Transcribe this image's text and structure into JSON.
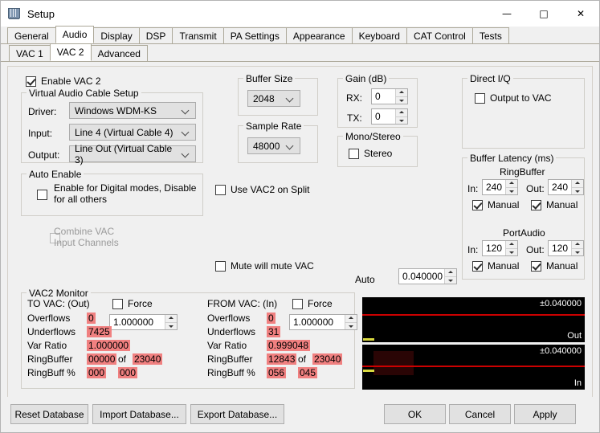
{
  "window": {
    "title": "Setup",
    "icon": "app-icon",
    "controls": {
      "minimize": "—",
      "maximize": "☐",
      "close": "✕"
    }
  },
  "tabs_main": [
    {
      "label": "General",
      "active": false
    },
    {
      "label": "Audio",
      "active": true
    },
    {
      "label": "Display",
      "active": false
    },
    {
      "label": "DSP",
      "active": false
    },
    {
      "label": "Transmit",
      "active": false
    },
    {
      "label": "PA Settings",
      "active": false
    },
    {
      "label": "Appearance",
      "active": false
    },
    {
      "label": "Keyboard",
      "active": false
    },
    {
      "label": "CAT Control",
      "active": false
    },
    {
      "label": "Tests",
      "active": false
    }
  ],
  "tabs_sub": [
    {
      "label": "VAC 1",
      "active": false
    },
    {
      "label": "VAC 2",
      "active": true
    },
    {
      "label": "Advanced",
      "active": false
    }
  ],
  "enable_vac": {
    "label": "Enable VAC 2",
    "checked": true
  },
  "vac_setup": {
    "title": "Virtual Audio Cable Setup",
    "driver_label": "Driver:",
    "driver_value": "Windows WDM-KS",
    "input_label": "Input:",
    "input_value": "Line 4 (Virtual Cable 4)",
    "output_label": "Output:",
    "output_value": "Line Out (Virtual Cable 3)"
  },
  "auto_enable": {
    "title": "Auto Enable",
    "checkbox_line1": "Enable for Digital modes, Disable",
    "checkbox_line2": "for all others",
    "checked": false
  },
  "combine_vac": {
    "line1": "Combine VAC",
    "line2": "Input Channels",
    "checked": false,
    "disabled": true
  },
  "buffer_size": {
    "title": "Buffer Size",
    "value": "2048"
  },
  "sample_rate": {
    "title": "Sample Rate",
    "value": "48000"
  },
  "gain": {
    "title": "Gain (dB)",
    "rx_label": "RX:",
    "rx_value": "0",
    "tx_label": "TX:",
    "tx_value": "0"
  },
  "mono_stereo": {
    "title": "Mono/Stereo",
    "label": "Stereo",
    "checked": false
  },
  "use_vac2_split": {
    "label": "Use VAC2 on Split",
    "checked": false
  },
  "mute_will_mute": {
    "label": "Mute will mute VAC",
    "checked": false
  },
  "auto_field": {
    "label": "Auto",
    "checked": false,
    "value": "0.040000"
  },
  "direct_iq": {
    "title": "Direct I/Q",
    "label": "Output to VAC",
    "checked": false
  },
  "buffer_latency": {
    "title": "Buffer Latency (ms)",
    "ringbuffer": {
      "title": "RingBuffer",
      "in_label": "In:",
      "in_value": "240",
      "in_manual": "Manual",
      "in_manual_checked": true,
      "out_label": "Out:",
      "out_value": "240",
      "out_manual": "Manual",
      "out_manual_checked": true
    },
    "portaudio": {
      "title": "PortAudio",
      "in_label": "In:",
      "in_value": "120",
      "in_manual": "Manual",
      "in_manual_checked": true,
      "out_label": "Out:",
      "out_value": "120",
      "out_manual": "Manual",
      "out_manual_checked": true
    }
  },
  "monitor": {
    "title": "VAC2 Monitor",
    "rows": [
      "Overflows",
      "Underflows",
      "Var Ratio",
      "RingBuffer",
      "RingBuff %"
    ],
    "of_label": "of",
    "out": {
      "heading": "TO VAC: (Out)",
      "force_label": "Force",
      "force_checked": false,
      "force_value": "1.000000",
      "overflows": "0",
      "underflows": "7425",
      "var_ratio": "1.000000",
      "ringbuffer_cur": "00000",
      "ringbuffer_max": "23040",
      "ringbuff_pct_a": "000",
      "ringbuff_pct_b": "000"
    },
    "in": {
      "heading": "FROM VAC: (In)",
      "force_label": "Force",
      "force_checked": false,
      "force_value": "1.000000",
      "overflows": "0",
      "underflows": "31",
      "var_ratio": "0.999048",
      "ringbuffer_cur": "12843",
      "ringbuffer_max": "23040",
      "ringbuff_pct_a": "056",
      "ringbuff_pct_b": "045"
    }
  },
  "scopes": [
    {
      "scale": "±0.040000",
      "corner": "Out"
    },
    {
      "scale": "±0.040000",
      "corner": "In"
    }
  ],
  "buttons": {
    "reset_db": "Reset Database",
    "import_db": "Import Database...",
    "export_db": "Export Database...",
    "ok": "OK",
    "cancel": "Cancel",
    "apply": "Apply"
  },
  "colors": {
    "highlight": "#f08080",
    "scope_bg": "#000000",
    "scope_line": "#cc0000",
    "window_bg": "#f0f0f0"
  }
}
